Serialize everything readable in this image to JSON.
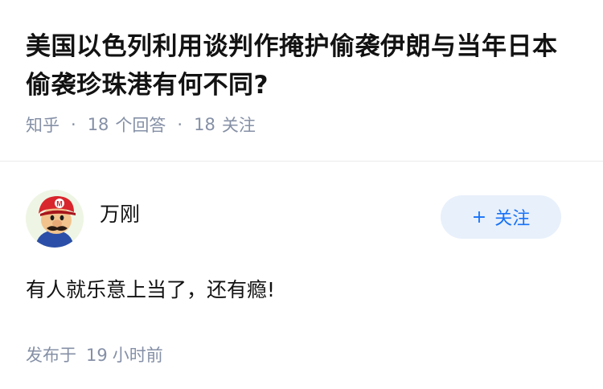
{
  "question": {
    "title": "美国以色列利用谈判作掩护偷袭伊朗与当年日本偷袭珍珠港有何不同?",
    "source": "知乎",
    "answer_count": "18",
    "answer_label": "个回答",
    "follower_count": "18",
    "follow_label": "关注"
  },
  "answer": {
    "author_name": "万刚",
    "follow_button_label": "关注",
    "follow_button_icon": "plus-icon",
    "content": "有人就乐意上当了，还有瘾!",
    "time_prefix": "发布于",
    "time_value": "19",
    "time_suffix": "小时前"
  },
  "colors": {
    "accent": "#1772f6",
    "follow_bg": "#e8f0fb",
    "meta_text": "#8590a6",
    "title_text": "#121212"
  }
}
